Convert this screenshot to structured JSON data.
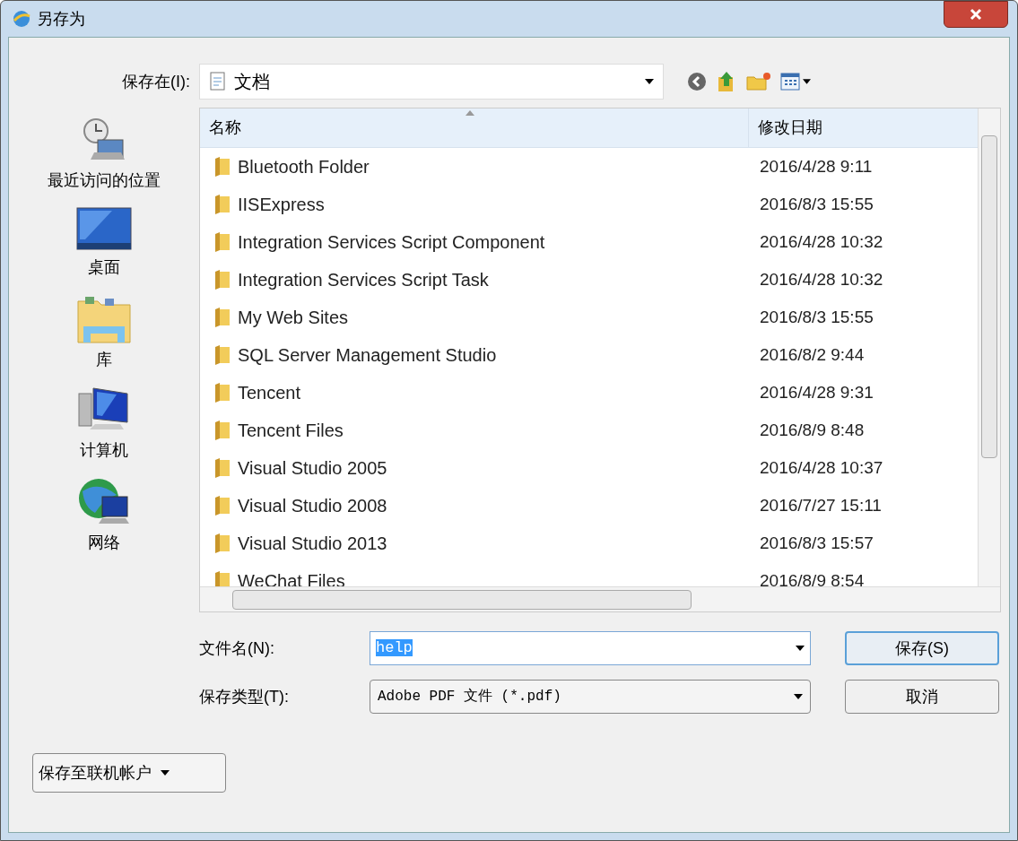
{
  "window": {
    "title": "另存为"
  },
  "save_in": {
    "label": "保存在(I):",
    "value": "文档"
  },
  "places": [
    {
      "label": "最近访问的位置",
      "kind": "recent"
    },
    {
      "label": "桌面",
      "kind": "desktop"
    },
    {
      "label": "库",
      "kind": "library"
    },
    {
      "label": "计算机",
      "kind": "computer"
    },
    {
      "label": "网络",
      "kind": "network"
    }
  ],
  "file_list": {
    "columns": [
      "名称",
      "修改日期"
    ],
    "rows": [
      {
        "name": "Bluetooth Folder",
        "modified": "2016/4/28 9:11"
      },
      {
        "name": "IISExpress",
        "modified": "2016/8/3 15:55"
      },
      {
        "name": "Integration Services Script Component",
        "modified": "2016/4/28 10:32"
      },
      {
        "name": "Integration Services Script Task",
        "modified": "2016/4/28 10:32"
      },
      {
        "name": "My Web Sites",
        "modified": "2016/8/3 15:55"
      },
      {
        "name": "SQL Server Management Studio",
        "modified": "2016/8/2 9:44"
      },
      {
        "name": "Tencent",
        "modified": "2016/4/28 9:31"
      },
      {
        "name": "Tencent Files",
        "modified": "2016/8/9 8:48"
      },
      {
        "name": "Visual Studio 2005",
        "modified": "2016/4/28 10:37"
      },
      {
        "name": "Visual Studio 2008",
        "modified": "2016/7/27 15:11"
      },
      {
        "name": "Visual Studio 2013",
        "modified": "2016/8/3 15:57"
      },
      {
        "name": "WeChat Files",
        "modified": "2016/8/9 8:54"
      }
    ]
  },
  "filename": {
    "label": "文件名(N):",
    "value": "help",
    "selected": true
  },
  "file_type": {
    "label": "保存类型(T):",
    "value": "Adobe PDF 文件 (*.pdf)"
  },
  "buttons": [
    {
      "label": "保存(S)",
      "kind": "default"
    },
    {
      "label": "取消",
      "kind": "normal"
    }
  ],
  "online_button": {
    "label": "保存至联机帐户"
  }
}
